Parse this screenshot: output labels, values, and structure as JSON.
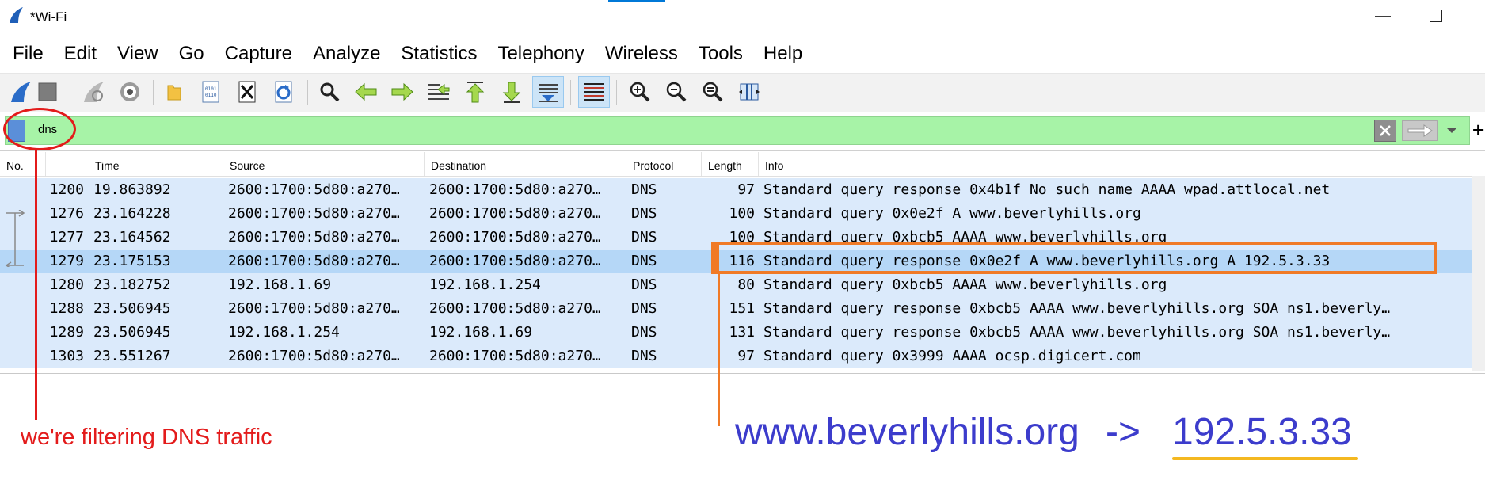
{
  "window": {
    "title": "*Wi-Fi",
    "minimize_glyph": "—"
  },
  "menu": [
    "File",
    "Edit",
    "View",
    "Go",
    "Capture",
    "Analyze",
    "Statistics",
    "Telephony",
    "Wireless",
    "Tools",
    "Help"
  ],
  "toolbar": {
    "buttons": [
      "start-capture-icon",
      "stop-capture-icon",
      "restart-capture-icon",
      "capture-options-icon",
      "open-file-icon",
      "save-file-icon",
      "close-file-icon",
      "reload-file-icon",
      "find-packet-icon",
      "go-back-icon",
      "go-forward-icon",
      "go-to-packet-icon",
      "go-first-icon",
      "go-last-icon",
      "auto-scroll-icon",
      "colorize-icon",
      "zoom-in-icon",
      "zoom-out-icon",
      "normal-size-icon",
      "resize-columns-icon"
    ],
    "active": [
      "auto-scroll-icon",
      "colorize-icon"
    ]
  },
  "filter": {
    "text": "dns",
    "bar_color": "#a7f3a7",
    "add_label": "+"
  },
  "packet_list": {
    "columns": [
      "No.",
      "Time",
      "Source",
      "Destination",
      "Protocol",
      "Length",
      "Info"
    ],
    "rows": [
      {
        "no": "1200",
        "time": "19.863892",
        "source": "2600:1700:5d80:a270…",
        "destination": "2600:1700:5d80:a270…",
        "protocol": "DNS",
        "length": "97",
        "info": "Standard query response 0x4b1f No such name AAAA wpad.attlocal.net"
      },
      {
        "no": "1276",
        "time": "23.164228",
        "source": "2600:1700:5d80:a270…",
        "destination": "2600:1700:5d80:a270…",
        "protocol": "DNS",
        "length": "100",
        "info": "Standard query 0x0e2f A www.beverlyhills.org"
      },
      {
        "no": "1277",
        "time": "23.164562",
        "source": "2600:1700:5d80:a270…",
        "destination": "2600:1700:5d80:a270…",
        "protocol": "DNS",
        "length": "100",
        "info": "Standard query 0xbcb5 AAAA www.beverlyhills.org"
      },
      {
        "no": "1279",
        "time": "23.175153",
        "source": "2600:1700:5d80:a270…",
        "destination": "2600:1700:5d80:a270…",
        "protocol": "DNS",
        "length": "116",
        "info": "Standard query response 0x0e2f A www.beverlyhills.org A 192.5.3.33",
        "selected": true
      },
      {
        "no": "1280",
        "time": "23.182752",
        "source": "192.168.1.69",
        "destination": "192.168.1.254",
        "protocol": "DNS",
        "length": "80",
        "info": "Standard query 0xbcb5 AAAA www.beverlyhills.org"
      },
      {
        "no": "1288",
        "time": "23.506945",
        "source": "2600:1700:5d80:a270…",
        "destination": "2600:1700:5d80:a270…",
        "protocol": "DNS",
        "length": "151",
        "info": "Standard query response 0xbcb5 AAAA www.beverlyhills.org SOA ns1.beverly…"
      },
      {
        "no": "1289",
        "time": "23.506945",
        "source": "192.168.1.254",
        "destination": "192.168.1.69",
        "protocol": "DNS",
        "length": "131",
        "info": "Standard query response 0xbcb5 AAAA www.beverlyhills.org SOA ns1.beverly…"
      },
      {
        "no": "1303",
        "time": "23.551267",
        "source": "2600:1700:5d80:a270…",
        "destination": "2600:1700:5d80:a270…",
        "protocol": "DNS",
        "length": "97",
        "info": "Standard query 0x3999 AAAA ocsp.digicert.com"
      }
    ],
    "row_color": "#dbeafb",
    "selected_row_color": "#b5d7f7"
  },
  "annotations": {
    "filter_note": "we're filtering DNS traffic",
    "resolution_host": "www.beverlyhills.org",
    "resolution_arrow": "->",
    "resolution_ip": "192.5.3.33",
    "filter_note_color": "#e31b1b",
    "highlight_color": "#f07a26",
    "resolution_color": "#3c3ccc",
    "underline_color": "#f4b820"
  }
}
